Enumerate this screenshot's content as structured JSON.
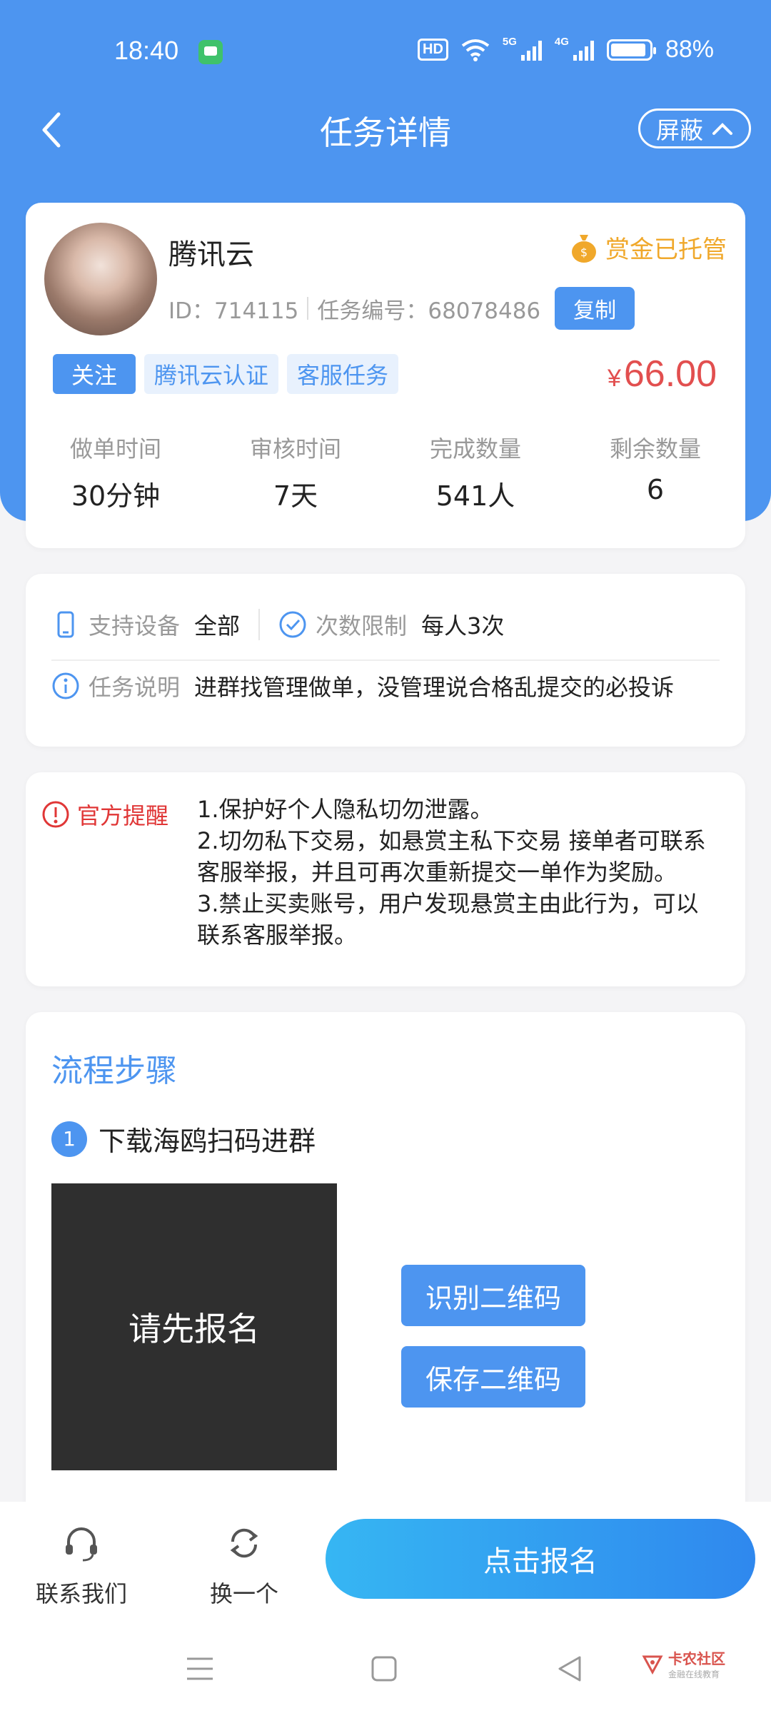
{
  "status_bar": {
    "time": "18:40",
    "network_hd": "HD",
    "net1": "5G",
    "net2": "4G",
    "battery": "88%"
  },
  "nav": {
    "title": "任务详情",
    "mask_label": "屏蔽"
  },
  "task": {
    "name": "腾讯云",
    "escrow_label": "赏金已托管",
    "id_text": "ID：714115",
    "task_no_text": "任务编号：68078486",
    "copy_label": "复制",
    "tags": [
      "关注",
      "腾讯云认证",
      "客服任务"
    ],
    "price_symbol": "¥",
    "price": "66.00",
    "stats": [
      {
        "label": "做单时间",
        "value": "30分钟"
      },
      {
        "label": "审核时间",
        "value": "7天"
      },
      {
        "label": "完成数量",
        "value": "541人"
      },
      {
        "label": "剩余数量",
        "value": "6"
      }
    ]
  },
  "info": {
    "device_label": "支持设备",
    "device_value": "全部",
    "limit_label": "次数限制",
    "limit_value": "每人3次",
    "desc_label": "任务说明",
    "desc_value": "进群找管理做单，没管理说合格乱提交的必投诉"
  },
  "notice": {
    "title": "官方提醒",
    "lines": [
      "1.保护好个人隐私切勿泄露。",
      "2.切勿私下交易，如悬赏主私下交易 接单者可联系",
      "客服举报，并且可再次重新提交一单作为奖励。",
      "3.禁止买卖账号，用户发现悬赏主由此行为，可以",
      "联系客服举报。"
    ]
  },
  "steps": {
    "title": "流程步骤",
    "step1_num": "1",
    "step1_text": "下载海鸥扫码进群",
    "qr_placeholder": "请先报名",
    "identify_label": "识别二维码",
    "save_label": "保存二维码"
  },
  "bottom": {
    "contact_label": "联系我们",
    "swap_label": "换一个",
    "signup_label": "点击报名"
  },
  "watermark": {
    "name": "卡农社区",
    "sub": "金融在线教育"
  },
  "colors": {
    "primary": "#4d95f0",
    "price": "#e24f4f",
    "escrow": "#f0a82b",
    "warning": "#e03636"
  }
}
